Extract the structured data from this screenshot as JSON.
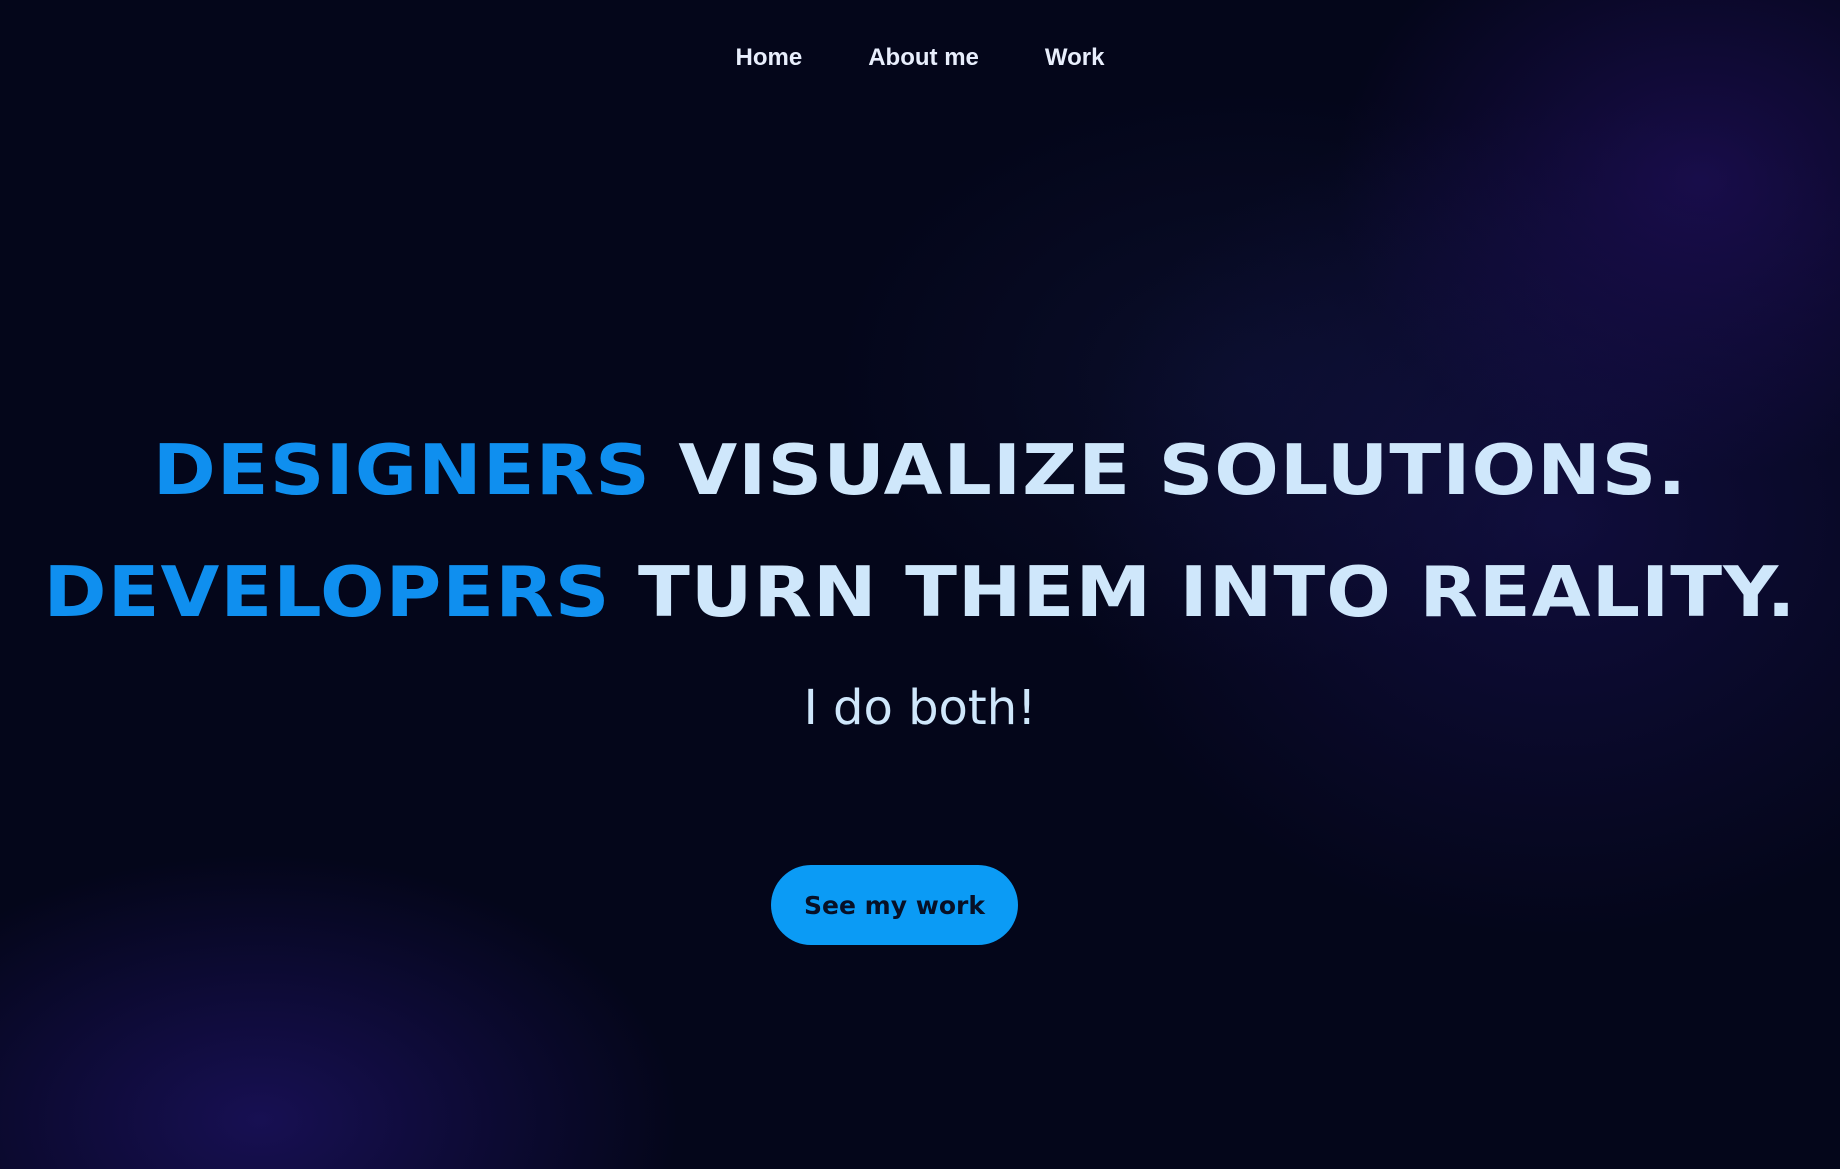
{
  "nav": {
    "items": [
      {
        "label": "Home"
      },
      {
        "label": "About me"
      },
      {
        "label": "Work"
      }
    ]
  },
  "hero": {
    "line1": {
      "accent": "DESIGNERS",
      "rest": "VISUALIZE SOLUTIONS."
    },
    "line2": {
      "accent": "DEVELOPERS",
      "rest": "TURN THEM INTO REALITY."
    },
    "subtitle": "I do both!",
    "cta_label": "See my work"
  },
  "colors": {
    "background": "#04061a",
    "accent": "#0f8fef",
    "headline_light": "#cfe7fb",
    "button": "#0b9bf5",
    "button_text": "#071026"
  }
}
